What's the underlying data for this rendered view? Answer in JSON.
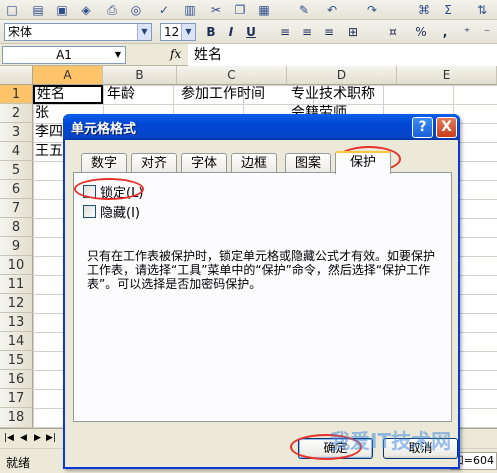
{
  "formatting": {
    "font_name": "宋体",
    "font_size": "12",
    "bold": "B",
    "italic": "I",
    "underline": "U",
    "percent": "%",
    "comma": ","
  },
  "formula_bar": {
    "name_box": "A1",
    "fx": "fx",
    "content": "姓名"
  },
  "grid": {
    "columns": [
      "A",
      "B",
      "C",
      "D",
      "E"
    ],
    "rows": [
      "1",
      "2",
      "3",
      "4",
      "5",
      "6",
      "7",
      "8",
      "9",
      "10",
      "11",
      "12",
      "13",
      "14",
      "15",
      "16",
      "17",
      "18"
    ],
    "cells": {
      "a1": "姓名",
      "b1": "年龄",
      "c1": "参加工作时间",
      "d1": "专业技术职称",
      "a2": "张",
      "a3": "李四",
      "a4": "王五",
      "d2": "会籍劳师"
    }
  },
  "status": {
    "left": "就绪",
    "right": "和=604"
  },
  "dialog": {
    "title": "单元格格式",
    "help": "?",
    "close": "X",
    "tabs": [
      "数字",
      "对齐",
      "字体",
      "边框",
      "图案",
      "保护"
    ],
    "active_tab": "保护",
    "locked_label": "锁定(L)",
    "locked_checked": false,
    "hidden_label": "隐藏(I)",
    "hidden_checked": false,
    "description": "只有在工作表被保护时，锁定单元格或隐藏公式才有效。如要保护工作表，请选择“工具”菜单中的“保护”命令，然后选择“保护工作表”。可以选择是否加密码保护。",
    "ok_label": "确定",
    "cancel_label": "取消"
  },
  "watermark": "我爱IT技术网",
  "colors": {
    "accent": "#0a3ad4",
    "annotation": "#e8302a"
  }
}
